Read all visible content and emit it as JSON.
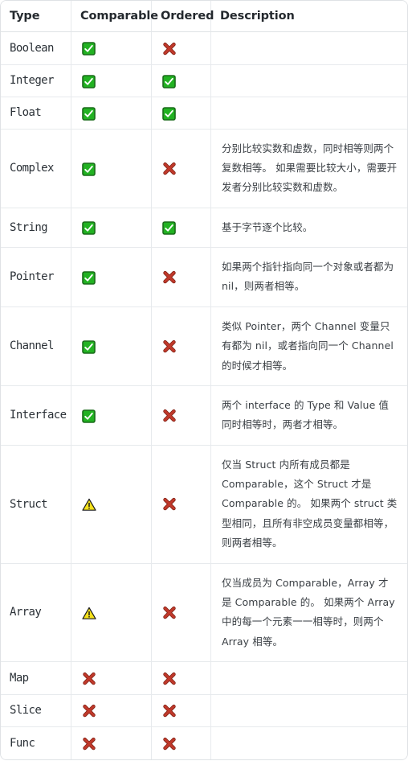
{
  "table": {
    "columns": [
      "Type",
      "Comparable",
      "Ordered",
      "Description"
    ],
    "icons": {
      "check": "green-check-icon",
      "cross": "red-cross-icon",
      "warn": "yellow-warning-icon"
    },
    "colors": {
      "check_fill": "#22b222",
      "check_border": "#1a6b1a",
      "cross_fill": "#c0392b",
      "cross_border": "#7a1f12",
      "warn_fill": "#f5e11a",
      "warn_border": "#1a1a1a",
      "border": "#dfe2e5",
      "header_text": "#24292e",
      "body_text": "#3a3f44"
    },
    "rows": [
      {
        "type": "Boolean",
        "comparable": "check",
        "ordered": "cross",
        "description": ""
      },
      {
        "type": "Integer",
        "comparable": "check",
        "ordered": "check",
        "description": ""
      },
      {
        "type": "Float",
        "comparable": "check",
        "ordered": "check",
        "description": ""
      },
      {
        "type": "Complex",
        "comparable": "check",
        "ordered": "cross",
        "description": "分别比较实数和虚数，同时相等则两个复数相等。 如果需要比较大小，需要开发者分别比较实数和虚数。"
      },
      {
        "type": "String",
        "comparable": "check",
        "ordered": "check",
        "description": "基于字节逐个比较。"
      },
      {
        "type": "Pointer",
        "comparable": "check",
        "ordered": "cross",
        "description": "如果两个指针指向同一个对象或者都为 nil，则两者相等。"
      },
      {
        "type": "Channel",
        "comparable": "check",
        "ordered": "cross",
        "description": "类似 Pointer，两个 Channel 变量只有都为 nil，或者指向同一个 Channel 的时候才相等。"
      },
      {
        "type": "Interface",
        "comparable": "check",
        "ordered": "cross",
        "description": "两个 interface 的 Type 和 Value 值同时相等时，两者才相等。"
      },
      {
        "type": "Struct",
        "comparable": "warn",
        "ordered": "cross",
        "description": "仅当 Struct 内所有成员都是 Comparable，这个 Struct 才是 Comparable 的。 如果两个 struct 类型相同，且所有非空成员变量都相等，则两者相等。"
      },
      {
        "type": "Array",
        "comparable": "warn",
        "ordered": "cross",
        "description": "仅当成员为 Comparable，Array 才是 Comparable 的。 如果两个 Array 中的每一个元素一一相等时，则两个 Array 相等。"
      },
      {
        "type": "Map",
        "comparable": "cross",
        "ordered": "cross",
        "description": ""
      },
      {
        "type": "Slice",
        "comparable": "cross",
        "ordered": "cross",
        "description": ""
      },
      {
        "type": "Func",
        "comparable": "cross",
        "ordered": "cross",
        "description": ""
      }
    ]
  }
}
